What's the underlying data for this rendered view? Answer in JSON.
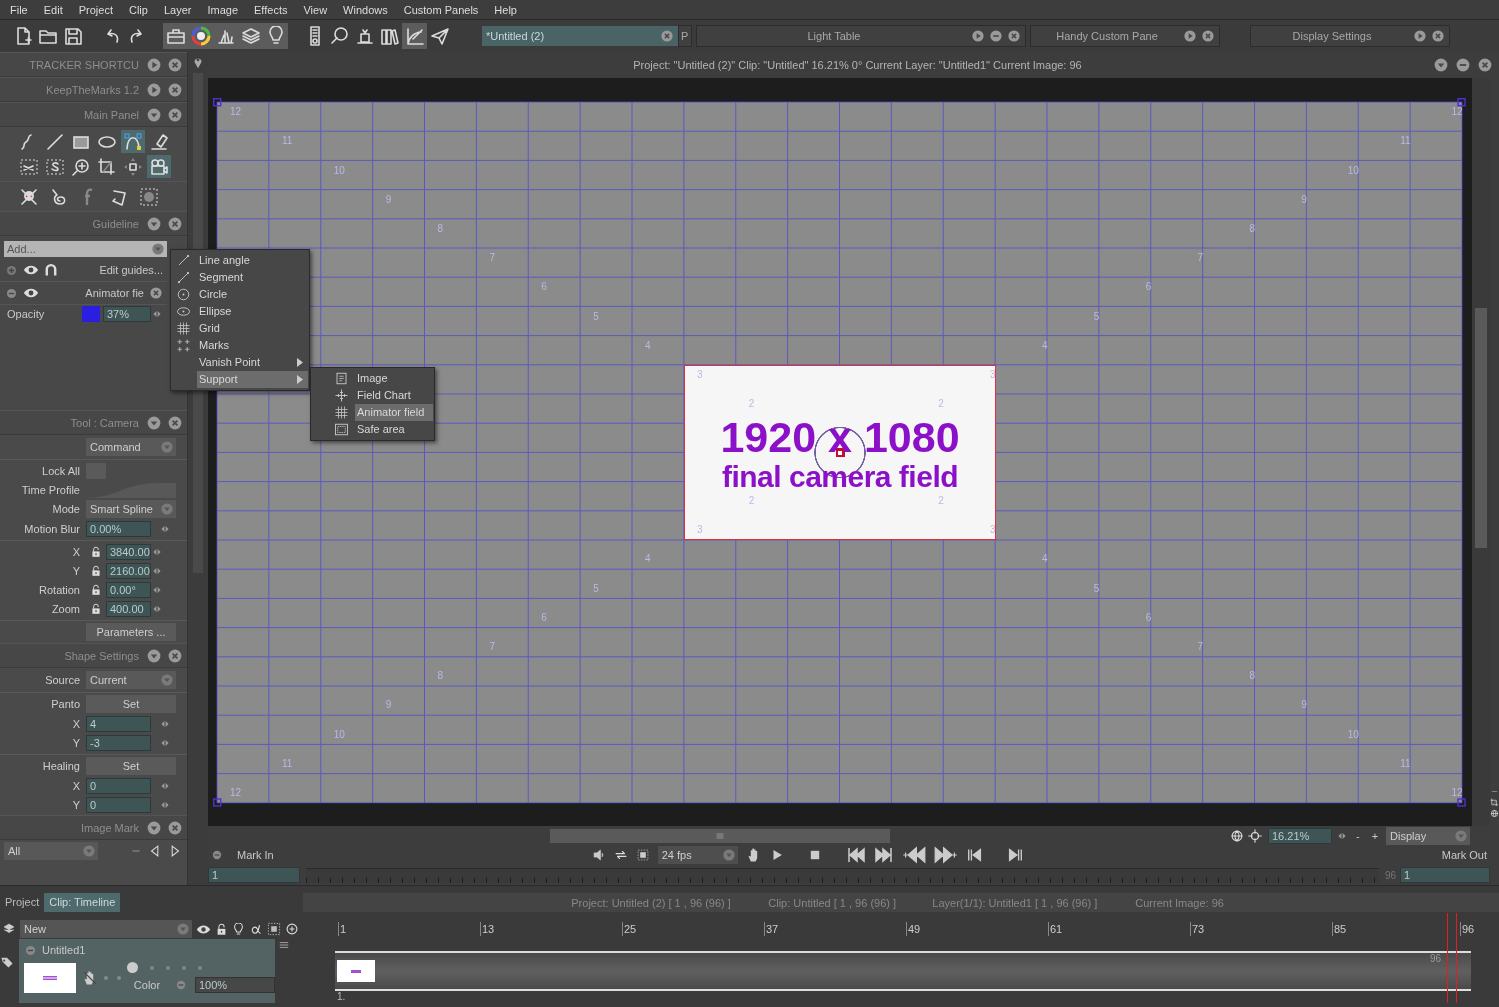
{
  "menubar": [
    "File",
    "Edit",
    "Project",
    "Clip",
    "Layer",
    "Image",
    "Effects",
    "View",
    "Windows",
    "Custom Panels",
    "Help"
  ],
  "toolbar": [
    {
      "selected": false
    },
    {
      "selected": false
    },
    {
      "selected": false
    },
    {
      "selected": false
    },
    {
      "selected": false
    },
    {
      "selected": true
    },
    {
      "selected": true
    },
    {
      "selected": true
    },
    {
      "selected": true
    },
    {
      "selected": true
    },
    {
      "selected": false
    },
    {
      "selected": false
    },
    {
      "selected": false
    },
    {
      "selected": false
    },
    {
      "selected": true
    },
    {
      "selected": false
    }
  ],
  "document_tab": {
    "title": "*Untitled (2)"
  },
  "panel_tabs": [
    {
      "title": "P"
    },
    {
      "title": "Light Table"
    },
    {
      "title": "Handy Custom Pane"
    },
    {
      "title": "Display Settings"
    }
  ],
  "sidebar": {
    "panels": [
      {
        "title": "TRACKER SHORTCU",
        "expanded": false
      },
      {
        "title": "KeepTheMarks 1.2",
        "expanded": false
      },
      {
        "title": "Main Panel",
        "expanded": true,
        "kind": "tools",
        "tools": [
          {
            "selected": false
          },
          {
            "selected": false
          },
          {
            "selected": false
          },
          {
            "selected": false
          },
          {
            "selected": true
          },
          {
            "selected": false
          },
          {
            "selected": false
          },
          {
            "selected": false
          },
          {
            "selected": false
          },
          {
            "selected": false
          },
          {
            "selected": false
          },
          {
            "selected": true
          },
          {
            "selected": false
          },
          {
            "selected": false
          },
          {
            "selected": false
          },
          {
            "selected": false
          },
          {
            "selected": false
          }
        ]
      },
      {
        "title": "Guideline",
        "expanded": true,
        "kind": "guides",
        "add": "Add...",
        "guides": [
          {
            "kind": "master",
            "label": "Edit guides...",
            "expanded": false,
            "visible": true
          },
          {
            "kind": "guide",
            "label": "Animator fie",
            "expanded": true,
            "visible": true,
            "opacity_label": "Opacity",
            "color": "#2a1ee0",
            "opacity": "37%"
          }
        ]
      },
      {
        "title": "Tool : Camera",
        "expanded": true,
        "kind": "form",
        "rows": [
          {
            "kind": "dropdown",
            "value": "Command"
          },
          {
            "kind": "divider"
          },
          {
            "kind": "checkbox",
            "label": "Lock All",
            "checked": false
          },
          {
            "kind": "curve",
            "label": "Time Profile"
          },
          {
            "kind": "dropdown",
            "label": "Mode",
            "value": "Smart Spline"
          },
          {
            "kind": "field",
            "label": "Motion Blur",
            "value": "0.00%"
          },
          {
            "kind": "divider"
          },
          {
            "kind": "locked-field",
            "label": "X",
            "value": "3840.00"
          },
          {
            "kind": "locked-field",
            "label": "Y",
            "value": "2160.00"
          },
          {
            "kind": "locked-field",
            "label": "Rotation",
            "value": "0.00°"
          },
          {
            "kind": "locked-field",
            "label": "Zoom",
            "value": "400.00"
          },
          {
            "kind": "divider"
          },
          {
            "kind": "button",
            "value": "Parameters ..."
          }
        ]
      },
      {
        "title": "Shape Settings",
        "expanded": true,
        "kind": "form",
        "rows": [
          {
            "kind": "dropdown",
            "label": "Source",
            "value": "Current"
          },
          {
            "kind": "divider"
          },
          {
            "kind": "button",
            "label": "Panto",
            "value": "Set"
          },
          {
            "kind": "field",
            "label": "X",
            "value": "4"
          },
          {
            "kind": "field",
            "label": "Y",
            "value": "-3"
          },
          {
            "kind": "divider"
          },
          {
            "kind": "button",
            "label": "Healing",
            "value": "Set"
          },
          {
            "kind": "field",
            "label": "X",
            "value": "0"
          },
          {
            "kind": "field",
            "label": "Y",
            "value": "0"
          }
        ]
      },
      {
        "title": "Image Mark",
        "expanded": true,
        "kind": "marks",
        "filter": "All"
      }
    ]
  },
  "guide_menu": {
    "items": [
      {
        "kind": "line-angle",
        "label": "Line angle",
        "selected": false,
        "submenu": false
      },
      {
        "kind": "segment",
        "label": "Segment",
        "selected": false,
        "submenu": false
      },
      {
        "kind": "circle",
        "label": "Circle",
        "selected": false,
        "submenu": false
      },
      {
        "kind": "ellipse",
        "label": "Ellipse",
        "selected": false,
        "submenu": false
      },
      {
        "kind": "grid",
        "label": "Grid",
        "selected": false,
        "submenu": false
      },
      {
        "kind": "marks",
        "label": "Marks",
        "selected": false,
        "submenu": false
      },
      {
        "kind": "none",
        "label": "Vanish Point",
        "selected": false,
        "submenu": true
      },
      {
        "kind": "none",
        "label": "Support",
        "selected": true,
        "submenu": true
      }
    ],
    "submenu": [
      {
        "kind": "image",
        "label": "Image",
        "selected": false
      },
      {
        "kind": "field-chart",
        "label": "Field Chart",
        "selected": false
      },
      {
        "kind": "grid",
        "label": "Animator field",
        "selected": true
      },
      {
        "kind": "safe-area",
        "label": "Safe area",
        "selected": false
      }
    ]
  },
  "viewport": {
    "info": "Project:  \"Untitled (2)\"  Clip: \"Untitled\"   16.21%   0°  Current Layer: \"Untitled1\"  Current Image: 96",
    "camera_field": {
      "title": "1920 x 1080",
      "subtitle": "final camera field"
    },
    "fields": [
      {
        "labels": [
          "12",
          "12",
          "12",
          "12"
        ]
      },
      {
        "labels": [
          "11",
          "11",
          "11",
          "11"
        ]
      },
      {
        "labels": [
          "10",
          "10",
          "10",
          "10"
        ]
      },
      {
        "labels": [
          "9",
          "9",
          "9",
          "9"
        ]
      },
      {
        "labels": [
          "8",
          "8",
          "8",
          "8"
        ]
      },
      {
        "labels": [
          "7",
          "7",
          "7",
          "7"
        ]
      },
      {
        "labels": [
          "6",
          "6",
          "6",
          "6"
        ]
      },
      {
        "labels": [
          "5",
          "5",
          "5",
          "5"
        ]
      },
      {
        "labels": [
          "4",
          "4",
          "4",
          "4"
        ]
      },
      {
        "labels": [
          "3",
          "3",
          "3",
          "3"
        ]
      },
      {
        "labels": [
          "2",
          "2",
          "2",
          "2"
        ]
      }
    ],
    "zoom": "16.21%",
    "zoom_out": "-",
    "zoom_in": "+",
    "display": "Display",
    "mark_in": "Mark In",
    "fps": "24 fps",
    "mark_out": "Mark Out",
    "start_frame": "1",
    "end_marker": "96",
    "current_frame": "1"
  },
  "timeline": {
    "tabs": [
      {
        "label": "Project",
        "selected": false
      },
      {
        "label": "Clip: Timeline",
        "selected": true
      }
    ],
    "info": [
      "Project: Untitled (2) [ 1 , 96  (96) ]",
      "Clip: Untitled [ 1 , 96  (96) ]",
      "Layer(1/1): Untitled1 [ 1 , 96  (96) ]",
      "Current Image: 96"
    ],
    "layer_mode": "New",
    "ruler": [
      "1",
      "13",
      "25",
      "37",
      "49",
      "61",
      "73",
      "85",
      "96"
    ],
    "track_end": "96",
    "track_start": "1.",
    "layers": [
      {
        "name": "Untitled1",
        "expanded": true,
        "color_label": "Color",
        "opacity": "100%"
      }
    ]
  }
}
